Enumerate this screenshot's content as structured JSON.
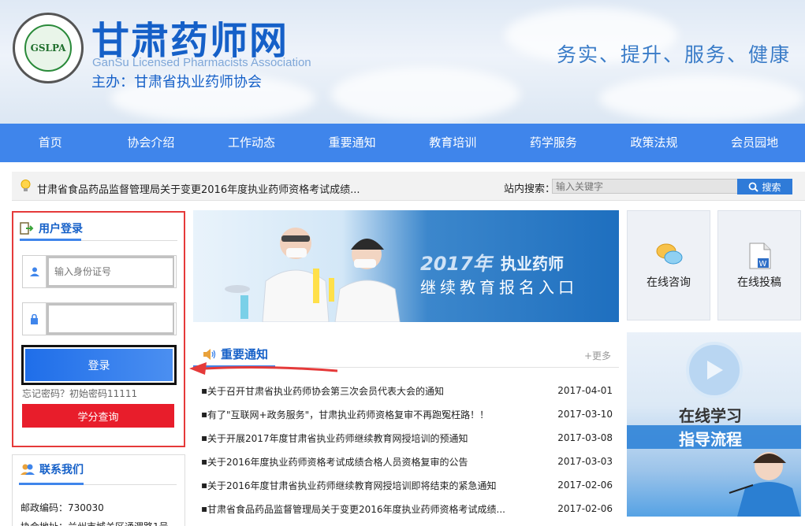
{
  "header": {
    "logo_abbr": "GSLPA",
    "title": "甘肃药师网",
    "subtitle": "GanSu Licensed Pharmacists Association",
    "host": "主办：甘肃省执业药师协会",
    "slogan": "务实、提升、服务、健康"
  },
  "nav": [
    {
      "label": "首页"
    },
    {
      "label": "协会介绍"
    },
    {
      "label": "工作动态"
    },
    {
      "label": "重要通知"
    },
    {
      "label": "教育培训"
    },
    {
      "label": "药学服务"
    },
    {
      "label": "政策法规"
    },
    {
      "label": "会员园地"
    }
  ],
  "notice": {
    "text": "甘肃省食品药品监督管理局关于变更2016年度执业药师资格考试成绩...",
    "search_label": "站内搜索：",
    "search_placeholder": "输入关键字",
    "search_button": "搜索"
  },
  "login": {
    "title": "用户登录",
    "id_placeholder": "输入身份证号",
    "password_placeholder": "",
    "button": "登录",
    "forgot": "忘记密码？初始密码11111",
    "credit_button": "学分查询"
  },
  "contact": {
    "title": "联系我们",
    "postcode": "邮政编码：730030",
    "address": "协会地址：兰州市城关区通渭路1号"
  },
  "banner": {
    "year": "2017年",
    "tag": "执业药师",
    "caption": "继续教育报名入口"
  },
  "tiles": [
    {
      "label": "在线咨询",
      "icon": "chat-bubbles-icon"
    },
    {
      "label": "在线投稿",
      "icon": "document-icon"
    }
  ],
  "study": {
    "line1": "在线学习",
    "line2": "指导流程"
  },
  "news": {
    "title": "重要通知",
    "more": "+更多",
    "items": [
      {
        "title": "关于召开甘肃省执业药师协会第三次会员代表大会的通知",
        "date": "2017-04-01"
      },
      {
        "title": "有了\"互联网+政务服务\"，甘肃执业药师资格复审不再跑冤枉路！！",
        "date": "2017-03-10"
      },
      {
        "title": "关于开展2017年度甘肃省执业药师继续教育网授培训的预通知",
        "date": "2017-03-08"
      },
      {
        "title": "关于2016年度执业药师资格考试成绩合格人员资格复审的公告",
        "date": "2017-03-03"
      },
      {
        "title": "关于2016年度甘肃省执业药师继续教育网授培训即将结束的紧急通知",
        "date": "2017-02-06"
      },
      {
        "title": "甘肃省食品药品监督管理局关于变更2016年度执业药师资格考试成绩...",
        "date": "2017-02-06"
      }
    ]
  },
  "colors": {
    "brand_blue": "#1560c8",
    "nav_blue": "#3f85eb",
    "highlight_red": "#e53a3a",
    "credit_red": "#e81d2b"
  }
}
